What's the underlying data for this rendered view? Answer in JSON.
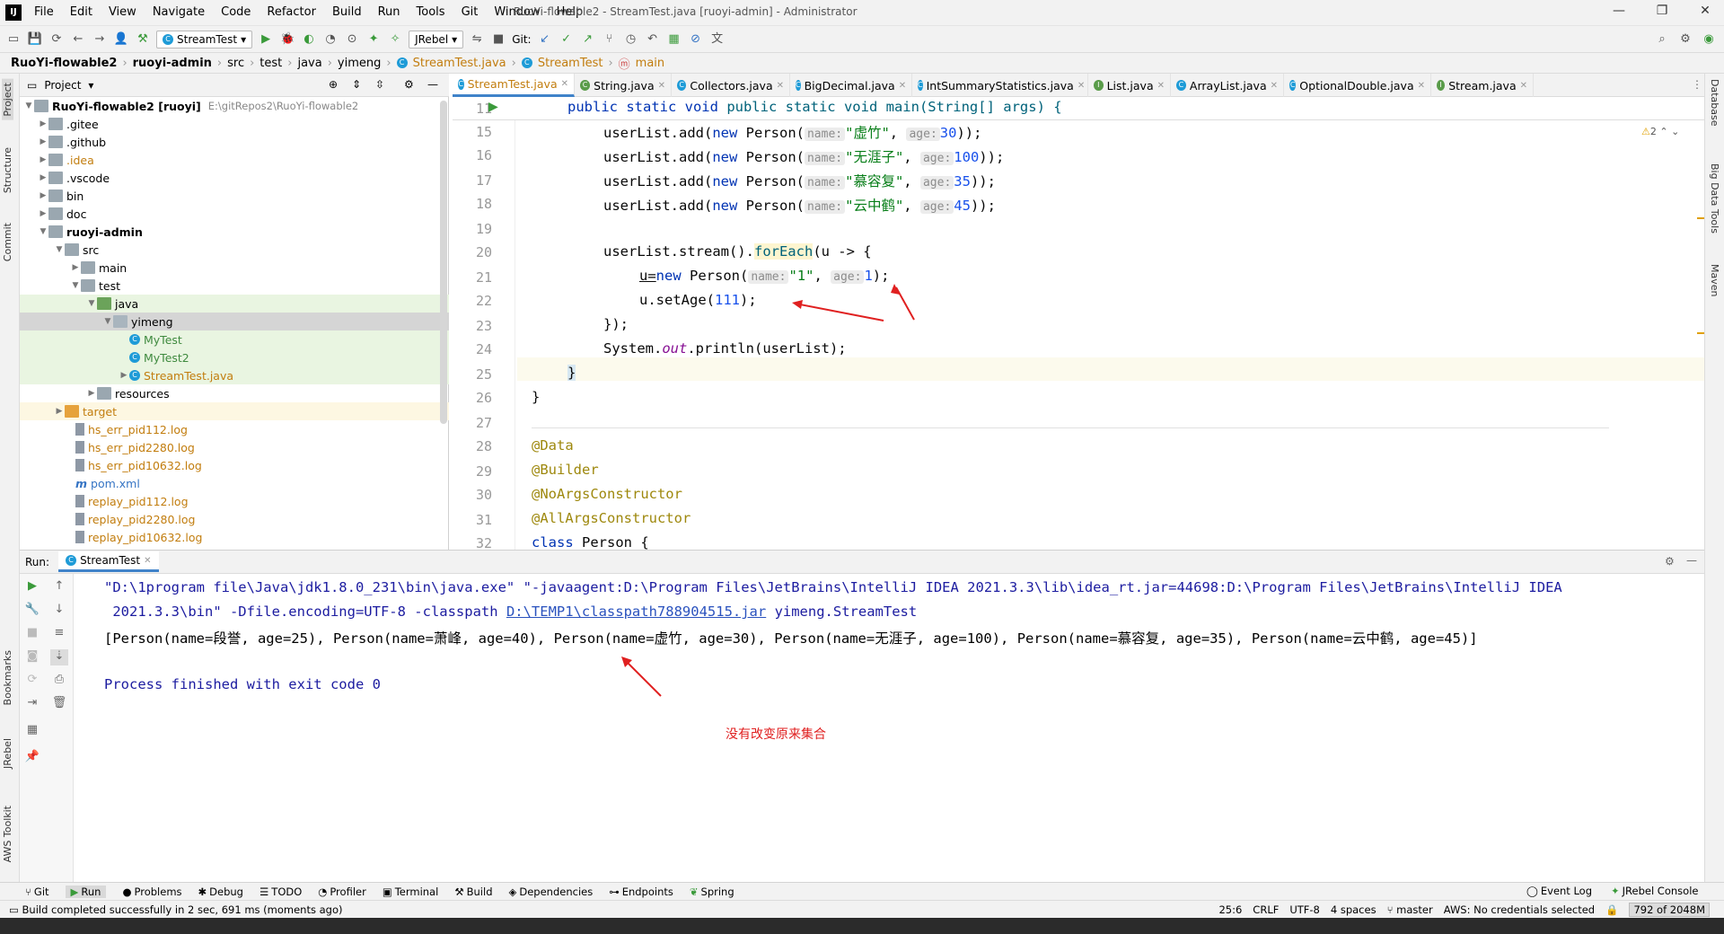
{
  "titlebar": {
    "window_title": "RuoYi-flowable2 - StreamTest.java [ruoyi-admin] - Administrator",
    "menu": [
      "File",
      "Edit",
      "View",
      "Navigate",
      "Code",
      "Refactor",
      "Build",
      "Run",
      "Tools",
      "Git",
      "Window",
      "Help"
    ]
  },
  "toolbar": {
    "run_config": "StreamTest",
    "jrebel": "JRebel",
    "git_label": "Git:"
  },
  "breadcrumb": [
    "RuoYi-flowable2",
    "ruoyi-admin",
    "src",
    "test",
    "java",
    "yimeng",
    "StreamTest.java",
    "StreamTest",
    "main"
  ],
  "left_strip": [
    "Project",
    "Structure",
    "Commit",
    "Bookmarks",
    "JRebel",
    "AWS Toolkit"
  ],
  "right_strip": [
    "Database",
    "Big Data Tools",
    "Maven"
  ],
  "project": {
    "header": "Project",
    "items": [
      {
        "label": "RuoYi-flowable2 [ruoyi]",
        "extra": "E:\\gitRepos2\\RuoYi-flowable2"
      },
      {
        "label": ".gitee"
      },
      {
        "label": ".github"
      },
      {
        "label": ".idea"
      },
      {
        "label": ".vscode"
      },
      {
        "label": "bin"
      },
      {
        "label": "doc"
      },
      {
        "label": "ruoyi-admin"
      },
      {
        "label": "src"
      },
      {
        "label": "main"
      },
      {
        "label": "test"
      },
      {
        "label": "java"
      },
      {
        "label": "yimeng"
      },
      {
        "label": "MyTest"
      },
      {
        "label": "MyTest2"
      },
      {
        "label": "StreamTest.java"
      },
      {
        "label": "resources"
      },
      {
        "label": "target"
      },
      {
        "label": "hs_err_pid112.log"
      },
      {
        "label": "hs_err_pid2280.log"
      },
      {
        "label": "hs_err_pid10632.log"
      },
      {
        "label": "pom.xml"
      },
      {
        "label": "replay_pid112.log"
      },
      {
        "label": "replay_pid2280.log"
      },
      {
        "label": "replay_pid10632.log"
      }
    ]
  },
  "editor_tabs": [
    "StreamTest.java",
    "String.java",
    "Collectors.java",
    "BigDecimal.java",
    "IntSummaryStatistics.java",
    "List.java",
    "ArrayList.java",
    "OptionalDouble.java",
    "Stream.java"
  ],
  "editor": {
    "sticky_line_no": "11",
    "sticky_code": "public static void main(String[] args) {",
    "warnings": "2",
    "line_numbers": [
      "15",
      "16",
      "17",
      "18",
      "19",
      "20",
      "21",
      "22",
      "23",
      "24",
      "25",
      "26",
      "27",
      "28",
      "29",
      "30",
      "31",
      "32"
    ],
    "hints": {
      "name": "name:",
      "age": "age:"
    },
    "lines": {
      "l15": {
        "pre": "userList.add(",
        "kw": "new",
        "cls": " Person(",
        "s": "\"虚竹\"",
        "n": "30",
        "end": "));"
      },
      "l16": {
        "pre": "userList.add(",
        "kw": "new",
        "cls": " Person(",
        "s": "\"无涯子\"",
        "n": "100",
        "end": "));"
      },
      "l17": {
        "pre": "userList.add(",
        "kw": "new",
        "cls": " Person(",
        "s": "\"慕容复\"",
        "n": "35",
        "end": "));"
      },
      "l18": {
        "pre": "userList.add(",
        "kw": "new",
        "cls": " Person(",
        "s": "\"云中鹤\"",
        "n": "45",
        "end": "));"
      },
      "l20a": "userList.stream().",
      "l20b": "forEach",
      "l20c": "(u -> {",
      "l21a": "u=",
      "l21b": "new",
      "l21c": " Person(",
      "l21s": "\"1\"",
      "l21n": "1",
      "l21e": ");",
      "l22a": "u.setAge(",
      "l22n": "111",
      "l22e": ");",
      "l23": "});",
      "l24a": "System.",
      "l24b": "out",
      "l24c": ".println(userList);",
      "l25": "}",
      "l26": "}",
      "l28": "@Data",
      "l29": "@Builder",
      "l30": "@NoArgsConstructor",
      "l31": "@AllArgsConstructor",
      "l32a": "class",
      "l32b": " Person {"
    }
  },
  "run": {
    "label": "Run:",
    "tab": "StreamTest",
    "cmd1": "\"D:\\1program file\\Java\\jdk1.8.0_231\\bin\\java.exe\" \"-javaagent:D:\\Program Files\\JetBrains\\IntelliJ IDEA 2021.3.3\\lib\\idea_rt.jar=44698:D:\\Program Files\\JetBrains\\IntelliJ IDEA",
    "cmd2a": " 2021.3.3\\bin\" -Dfile.encoding=UTF-8 -classpath ",
    "cmd2link": "D:\\TEMP1\\classpath788904515.jar",
    "cmd2b": " yimeng.StreamTest",
    "output": "[Person(name=段誉, age=25), Person(name=萧峰, age=40), Person(name=虚竹, age=30), Person(name=无涯子, age=100), Person(name=慕容复, age=35), Person(name=云中鹤, age=45)]",
    "exit": "Process finished with exit code 0",
    "annotation": "没有改变原来集合"
  },
  "bottom_tabs": [
    "Git",
    "Run",
    "Problems",
    "Debug",
    "TODO",
    "Profiler",
    "Terminal",
    "Build",
    "Dependencies",
    "Endpoints",
    "Spring"
  ],
  "bottom_right": [
    "Event Log",
    "JRebel Console"
  ],
  "status": {
    "message": "Build completed successfully in 2 sec, 691 ms (moments ago)",
    "position": "25:6",
    "line_sep": "CRLF",
    "encoding": "UTF-8",
    "indent": "4 spaces",
    "branch": "master",
    "aws": "AWS: No credentials selected",
    "memory": "792 of 2048M"
  },
  "colors": {
    "accent": "#4083c9",
    "annotation_red": "#e02020",
    "keyword": "#0033b3",
    "string": "#067d17"
  }
}
